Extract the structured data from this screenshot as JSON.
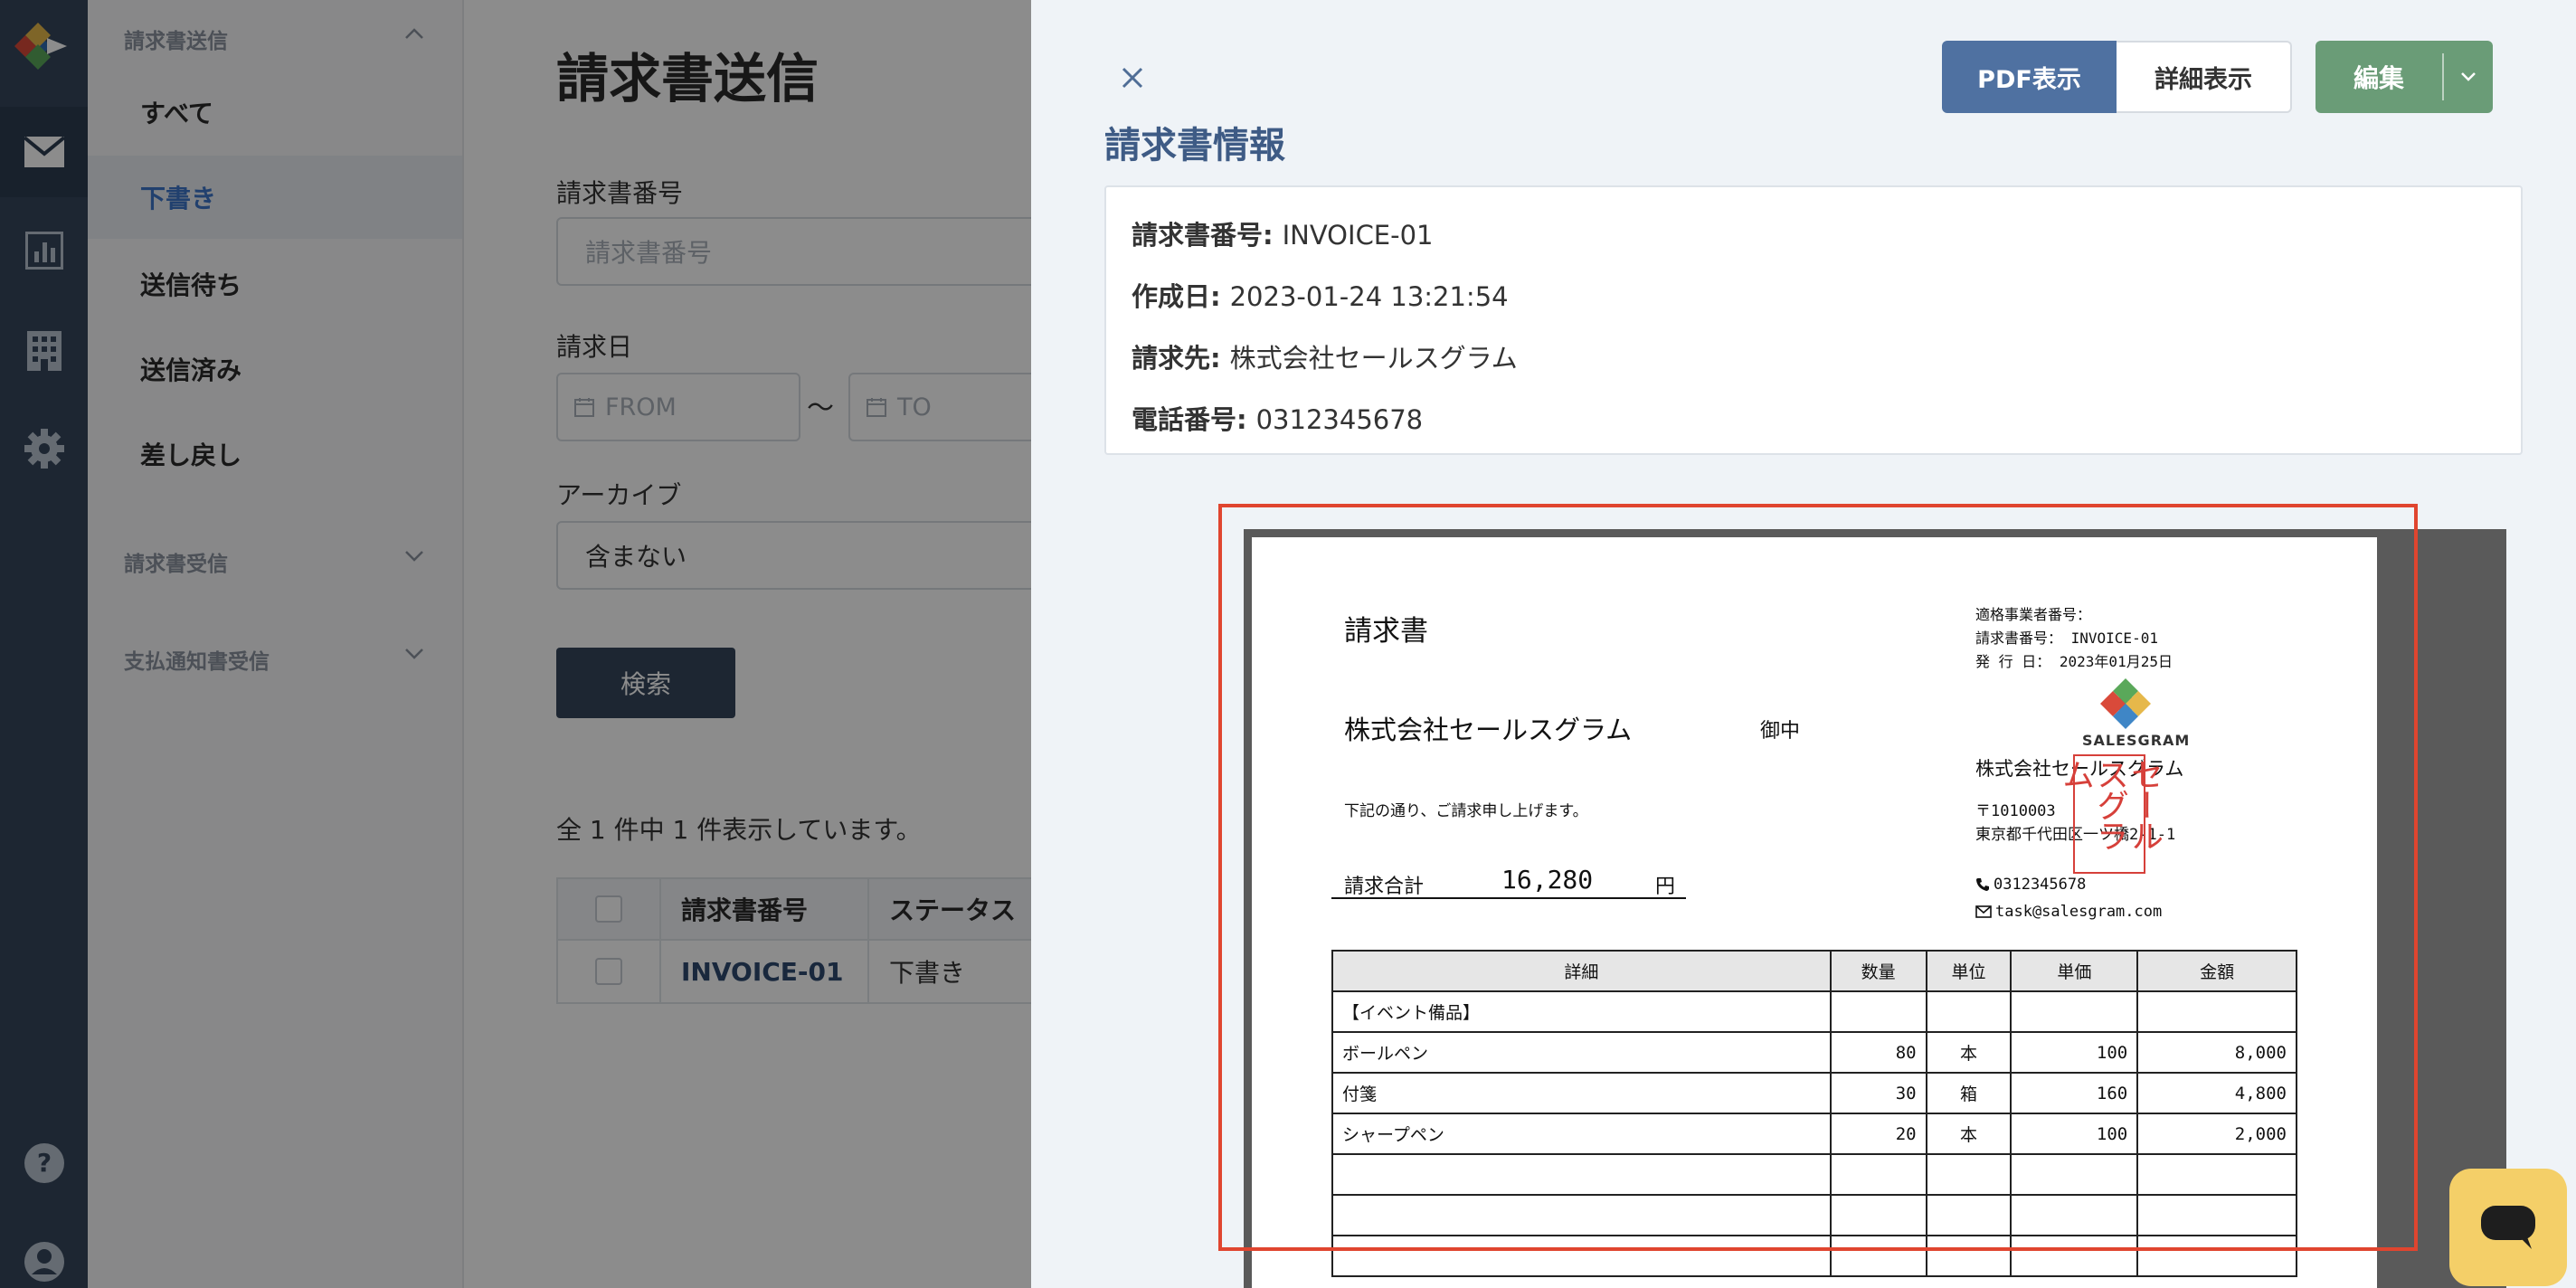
{
  "sidebar": {
    "group_send": "請求書送信",
    "items": [
      {
        "label": "すべて"
      },
      {
        "label": "下書き"
      },
      {
        "label": "送信待ち"
      },
      {
        "label": "送信済み"
      },
      {
        "label": "差し戻し"
      }
    ],
    "group_receive": "請求書受信",
    "group_payment": "支払通知書受信"
  },
  "main": {
    "title": "請求書送信",
    "invoice_no_label": "請求書番号",
    "invoice_no_placeholder": "請求書番号",
    "date_label": "請求日",
    "date_from_placeholder": "FROM",
    "date_to_placeholder": "TO",
    "date_sep": "〜",
    "archive_label": "アーカイブ",
    "archive_value": "含まない",
    "search_button": "検索",
    "result_count": "全 1 件中 1 件表示しています。",
    "table": {
      "headers": [
        "請求書番号",
        "ステータス"
      ],
      "rows": [
        {
          "invoice_no": "INVOICE-01",
          "status": "下書き"
        }
      ]
    }
  },
  "drawer": {
    "pdf_button": "PDF表示",
    "detail_button": "詳細表示",
    "edit_button": "編集",
    "info_title": "請求書情報",
    "fields": [
      {
        "label": "請求書番号:",
        "value": "INVOICE-01"
      },
      {
        "label": "作成日:",
        "value": "2023-01-24 13:21:54"
      },
      {
        "label": "請求先:",
        "value": "株式会社セールスグラム"
      },
      {
        "label": "電話番号:",
        "value": "0312345678"
      }
    ]
  },
  "invoice_doc": {
    "title": "請求書",
    "reg_no_label": "適格事業者番号：",
    "doc_no": "請求書番号： INVOICE-01",
    "issue_date": "発 行 日： 2023年01月25日",
    "client": "株式会社セールスグラム",
    "honorific": "御中",
    "message": "下記の通り、ご請求申し上げます。",
    "total_label": "請求合計",
    "total_value": "16,280",
    "total_unit": "円",
    "logo_text": "SALESGRAM",
    "sender_company": "株式会社セールスグラム",
    "sender_postal": "〒1010003",
    "sender_address": "東京都千代田区一ツ橋2-1-1",
    "sender_phone": "0312345678",
    "sender_email": "task@salesgram.com",
    "stamp_col1": "セール",
    "stamp_col2": "スグラム",
    "columns": [
      "詳細",
      "数量",
      "単位",
      "単価",
      "金額"
    ],
    "rows": [
      {
        "detail": "【イベント備品】",
        "qty": "",
        "unit": "",
        "price": "",
        "amount": ""
      },
      {
        "detail": "ボールペン",
        "qty": "80",
        "unit": "本",
        "price": "100",
        "amount": "8,000"
      },
      {
        "detail": "付箋",
        "qty": "30",
        "unit": "箱",
        "price": "160",
        "amount": "4,800"
      },
      {
        "detail": "シャープペン",
        "qty": "20",
        "unit": "本",
        "price": "100",
        "amount": "2,000"
      },
      {
        "detail": "",
        "qty": "",
        "unit": "",
        "price": "",
        "amount": ""
      },
      {
        "detail": "",
        "qty": "",
        "unit": "",
        "price": "",
        "amount": ""
      },
      {
        "detail": "",
        "qty": "",
        "unit": "",
        "price": "",
        "amount": ""
      }
    ]
  },
  "colors": {
    "rail_bg": "#35465c",
    "accent_blue": "#4f71a1",
    "edit_green": "#6a9c77",
    "preview_border": "#e0452f",
    "chat_yellow": "#f4cf68"
  },
  "icons": [
    "app-logo-icon",
    "mail-icon",
    "chart-icon",
    "building-icon",
    "gear-icon",
    "help-icon",
    "user-icon",
    "chevron-up-icon",
    "chevron-down-icon",
    "calendar-icon",
    "close-icon",
    "phone-icon",
    "envelope-icon",
    "chat-icon"
  ]
}
